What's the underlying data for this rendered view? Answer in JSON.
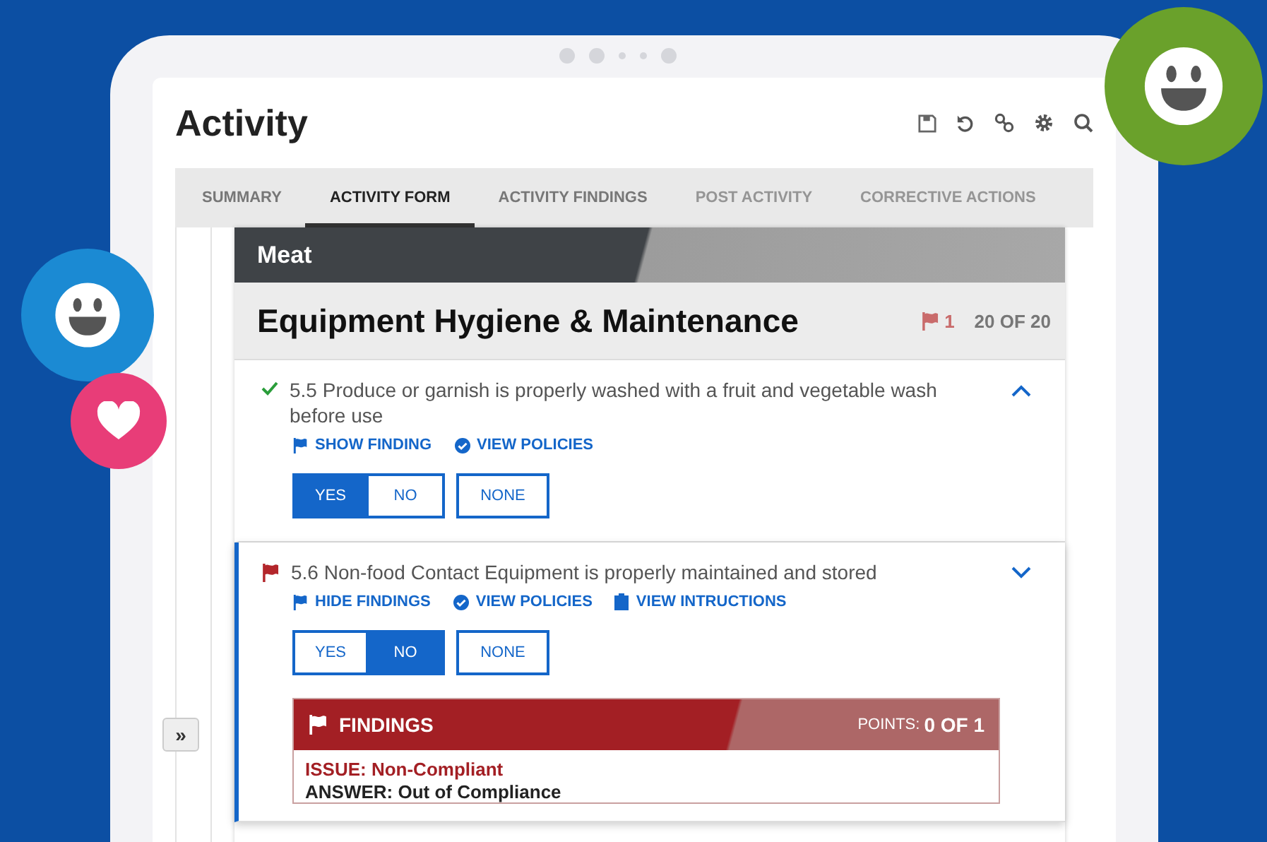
{
  "page": {
    "title": "Activity"
  },
  "tabs": [
    {
      "label": "SUMMARY",
      "selected": false,
      "disabled": false
    },
    {
      "label": "ACTIVITY FORM",
      "selected": true,
      "disabled": false
    },
    {
      "label": "ACTIVITY FINDINGS",
      "selected": false,
      "disabled": false
    },
    {
      "label": "POST ACTIVITY",
      "selected": false,
      "disabled": true
    },
    {
      "label": "CORRECTIVE ACTIONS",
      "selected": false,
      "disabled": true
    }
  ],
  "rail_button": "»",
  "section": {
    "category": "Meat",
    "title": "Equipment Hygiene & Maintenance",
    "flag_count": "1",
    "progress": "20 OF 20"
  },
  "questions": [
    {
      "kind": "passed",
      "active": false,
      "expanded": true,
      "text": "5.5 Produce or garnish is properly washed with a fruit and vegetable wash before use",
      "links": [
        {
          "kind": "flag",
          "label": "SHOW FINDING"
        },
        {
          "kind": "policy",
          "label": "VIEW POLICIES"
        }
      ],
      "choices": [
        {
          "label": "YES",
          "selected": true
        },
        {
          "label": "NO",
          "selected": false
        }
      ],
      "none": {
        "label": "NONE",
        "selected": false
      }
    },
    {
      "kind": "flagged",
      "active": true,
      "expanded": false,
      "text": "5.6 Non-food Contact Equipment is properly maintained and stored",
      "links": [
        {
          "kind": "flag",
          "label": "HIDE FINDINGS"
        },
        {
          "kind": "policy",
          "label": "VIEW POLICIES"
        },
        {
          "kind": "clipboard",
          "label": "VIEW INTRUCTIONS"
        }
      ],
      "choices": [
        {
          "label": "YES",
          "selected": false
        },
        {
          "label": "NO",
          "selected": true
        }
      ],
      "none": {
        "label": "NONE",
        "selected": false
      },
      "findings": {
        "title": "FINDINGS",
        "points_label": "POINTS:",
        "points": "0 OF 1",
        "issue": "ISSUE: Non-Compliant",
        "answer": "ANSWER: Out of Compliance"
      }
    }
  ]
}
